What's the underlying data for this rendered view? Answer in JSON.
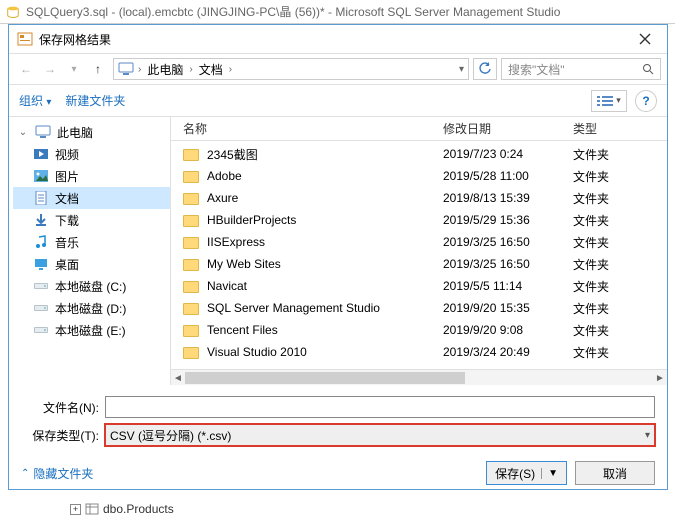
{
  "app": {
    "title": "SQLQuery3.sql - (local).emcbtc (JINGJING-PC\\晶 (56))* - Microsoft SQL Server Management Studio"
  },
  "dialog": {
    "title": "保存网格结果",
    "close_tooltip": "关闭"
  },
  "nav": {
    "crumbs": [
      "此电脑",
      "文档"
    ],
    "search_placeholder": "搜索\"文档\""
  },
  "toolbar": {
    "organize": "组织",
    "new_folder": "新建文件夹"
  },
  "tree": {
    "root": "此电脑",
    "items": [
      {
        "label": "视频",
        "icon": "video"
      },
      {
        "label": "图片",
        "icon": "picture"
      },
      {
        "label": "文档",
        "icon": "document",
        "selected": true
      },
      {
        "label": "下载",
        "icon": "download"
      },
      {
        "label": "音乐",
        "icon": "music"
      },
      {
        "label": "桌面",
        "icon": "desktop"
      },
      {
        "label": "本地磁盘 (C:)",
        "icon": "disk"
      },
      {
        "label": "本地磁盘 (D:)",
        "icon": "disk"
      },
      {
        "label": "本地磁盘 (E:)",
        "icon": "disk"
      }
    ]
  },
  "filelist": {
    "headers": {
      "name": "名称",
      "date": "修改日期",
      "type": "类型"
    },
    "rows": [
      {
        "name": "2345截图",
        "date": "2019/7/23 0:24",
        "type": "文件夹"
      },
      {
        "name": "Adobe",
        "date": "2019/5/28 11:00",
        "type": "文件夹"
      },
      {
        "name": "Axure",
        "date": "2019/8/13 15:39",
        "type": "文件夹"
      },
      {
        "name": "HBuilderProjects",
        "date": "2019/5/29 15:36",
        "type": "文件夹"
      },
      {
        "name": "IISExpress",
        "date": "2019/3/25 16:50",
        "type": "文件夹"
      },
      {
        "name": "My Web Sites",
        "date": "2019/3/25 16:50",
        "type": "文件夹"
      },
      {
        "name": "Navicat",
        "date": "2019/5/5 11:14",
        "type": "文件夹"
      },
      {
        "name": "SQL Server Management Studio",
        "date": "2019/9/20 15:35",
        "type": "文件夹"
      },
      {
        "name": "Tencent Files",
        "date": "2019/9/20 9:08",
        "type": "文件夹"
      },
      {
        "name": "Visual Studio 2010",
        "date": "2019/3/24 20:49",
        "type": "文件夹"
      }
    ]
  },
  "form": {
    "filename_label": "文件名(N):",
    "filename_value": "",
    "filetype_label": "保存类型(T):",
    "filetype_value": "CSV (逗号分隔) (*.csv)"
  },
  "footer": {
    "hide_folders": "隐藏文件夹",
    "save": "保存(S)",
    "cancel": "取消"
  },
  "tail": {
    "node": "dbo.Products"
  }
}
